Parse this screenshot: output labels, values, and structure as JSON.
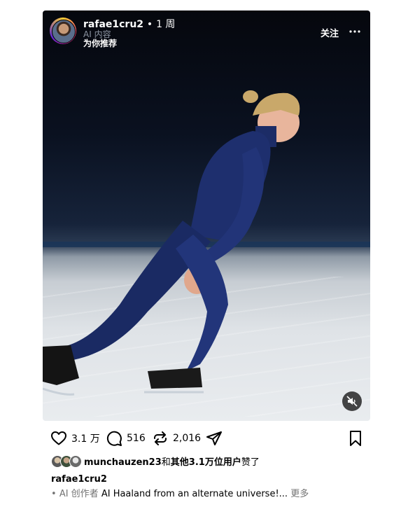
{
  "post": {
    "username": "rafae1cru2",
    "separator": "•",
    "time": "1 周",
    "ai_label": "AI 内容",
    "recommendation": "为你推荐",
    "follow_label": "关注"
  },
  "icons": {
    "more": "more-horizontal-icon",
    "mute": "speaker-muted-icon",
    "like": "heart-icon",
    "comment": "comment-bubble-icon",
    "repost": "repost-icon",
    "share": "send-icon",
    "save": "bookmark-icon"
  },
  "actions": {
    "likes": "3.1 万",
    "comments": "516",
    "reposts": "2,016"
  },
  "liked_by": {
    "user": "munchauzen23",
    "connector": "和",
    "others": "其他3.1万位用户",
    "suffix": "赞了"
  },
  "caption": {
    "username": "rafae1cru2",
    "bullet": "•",
    "ai_creator": "AI 创作者",
    "text": "AI Haaland from an alternate universe!...",
    "more": "更多"
  }
}
